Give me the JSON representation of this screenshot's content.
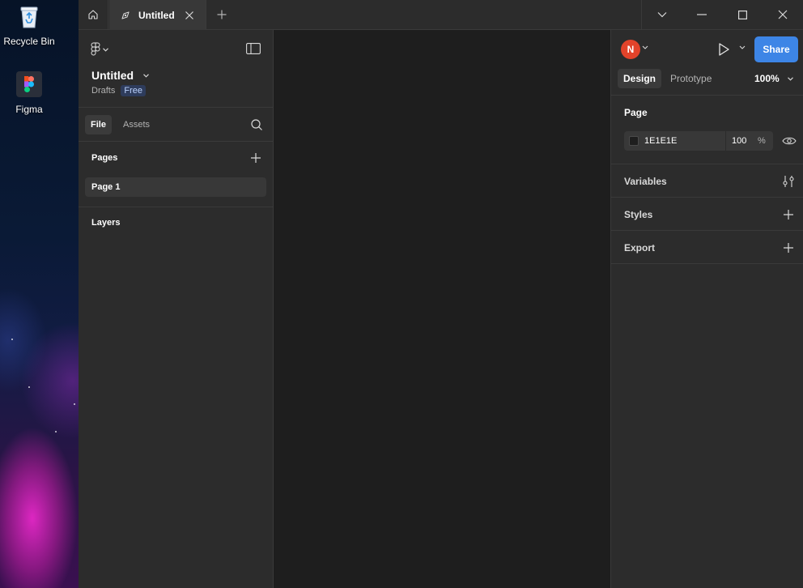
{
  "desktop": {
    "icons": [
      {
        "label": "Recycle Bin",
        "icon": "recycle-bin-icon"
      },
      {
        "label": "Figma",
        "icon": "figma-logo-icon"
      }
    ]
  },
  "titlebar": {
    "tab_title": "Untitled",
    "home_icon": "home-icon",
    "tab_icon": "figma-draft-icon",
    "close_icon": "close-icon",
    "new_tab_icon": "plus-icon",
    "window_controls": [
      "chevron-down-icon",
      "minimize-icon",
      "maximize-icon",
      "close-icon"
    ]
  },
  "left_panel": {
    "file_name": "Untitled",
    "location": "Drafts",
    "plan_badge": "Free",
    "tabs": [
      {
        "label": "File",
        "active": true
      },
      {
        "label": "Assets",
        "active": false
      }
    ],
    "pages_heading": "Pages",
    "pages": [
      {
        "label": "Page 1",
        "selected": true
      }
    ],
    "layers_heading": "Layers"
  },
  "right_panel": {
    "avatar_initial": "N",
    "avatar_color": "#e2432a",
    "share_label": "Share",
    "share_color": "#3d85e6",
    "tabs": [
      {
        "label": "Design",
        "active": true
      },
      {
        "label": "Prototype",
        "active": false
      }
    ],
    "zoom": "100%",
    "page_section": {
      "heading": "Page",
      "hex": "1E1E1E",
      "opacity": "100",
      "opacity_unit": "%"
    },
    "rows": [
      {
        "label": "Variables",
        "icon": "sliders-icon"
      },
      {
        "label": "Styles",
        "icon": "plus-icon"
      },
      {
        "label": "Export",
        "icon": "plus-icon"
      }
    ]
  },
  "colors": {
    "canvas": "#1e1e1e",
    "panel": "#2c2c2c",
    "page_swatch": "#1e1e1e"
  }
}
